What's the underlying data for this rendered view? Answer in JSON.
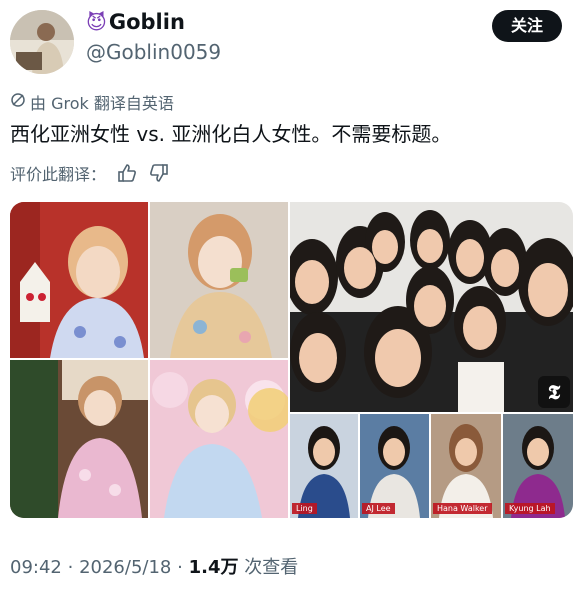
{
  "author": {
    "avatar_icon": "person-photo",
    "emoji_icon": "smiling-devil-emoji",
    "display_name": "Goblin",
    "handle": "@Goblin0059"
  },
  "actions": {
    "follow_label": "关注"
  },
  "translation": {
    "icon": "globe-icon",
    "label": "由 Grok 翻译自英语"
  },
  "tweet": {
    "text": "西化亚洲女性 vs. 亚洲化白人女性。不需要标题。"
  },
  "rate_translation": {
    "label": "评价此翻译：",
    "thumbs_up_icon": "thumbs-up-icon",
    "thumbs_down_icon": "thumbs-down-icon"
  },
  "media": {
    "news_captions": [
      "Ling",
      "AJ Lee",
      "Hana Walker",
      "Kyung Lah"
    ],
    "badge_icon": "nyt-logo-icon",
    "badge_text": "𝕿"
  },
  "meta": {
    "time": "09:42",
    "date": "2026/5/18",
    "views_count": "1.4万",
    "views_label": "次查看",
    "separator": "·"
  }
}
